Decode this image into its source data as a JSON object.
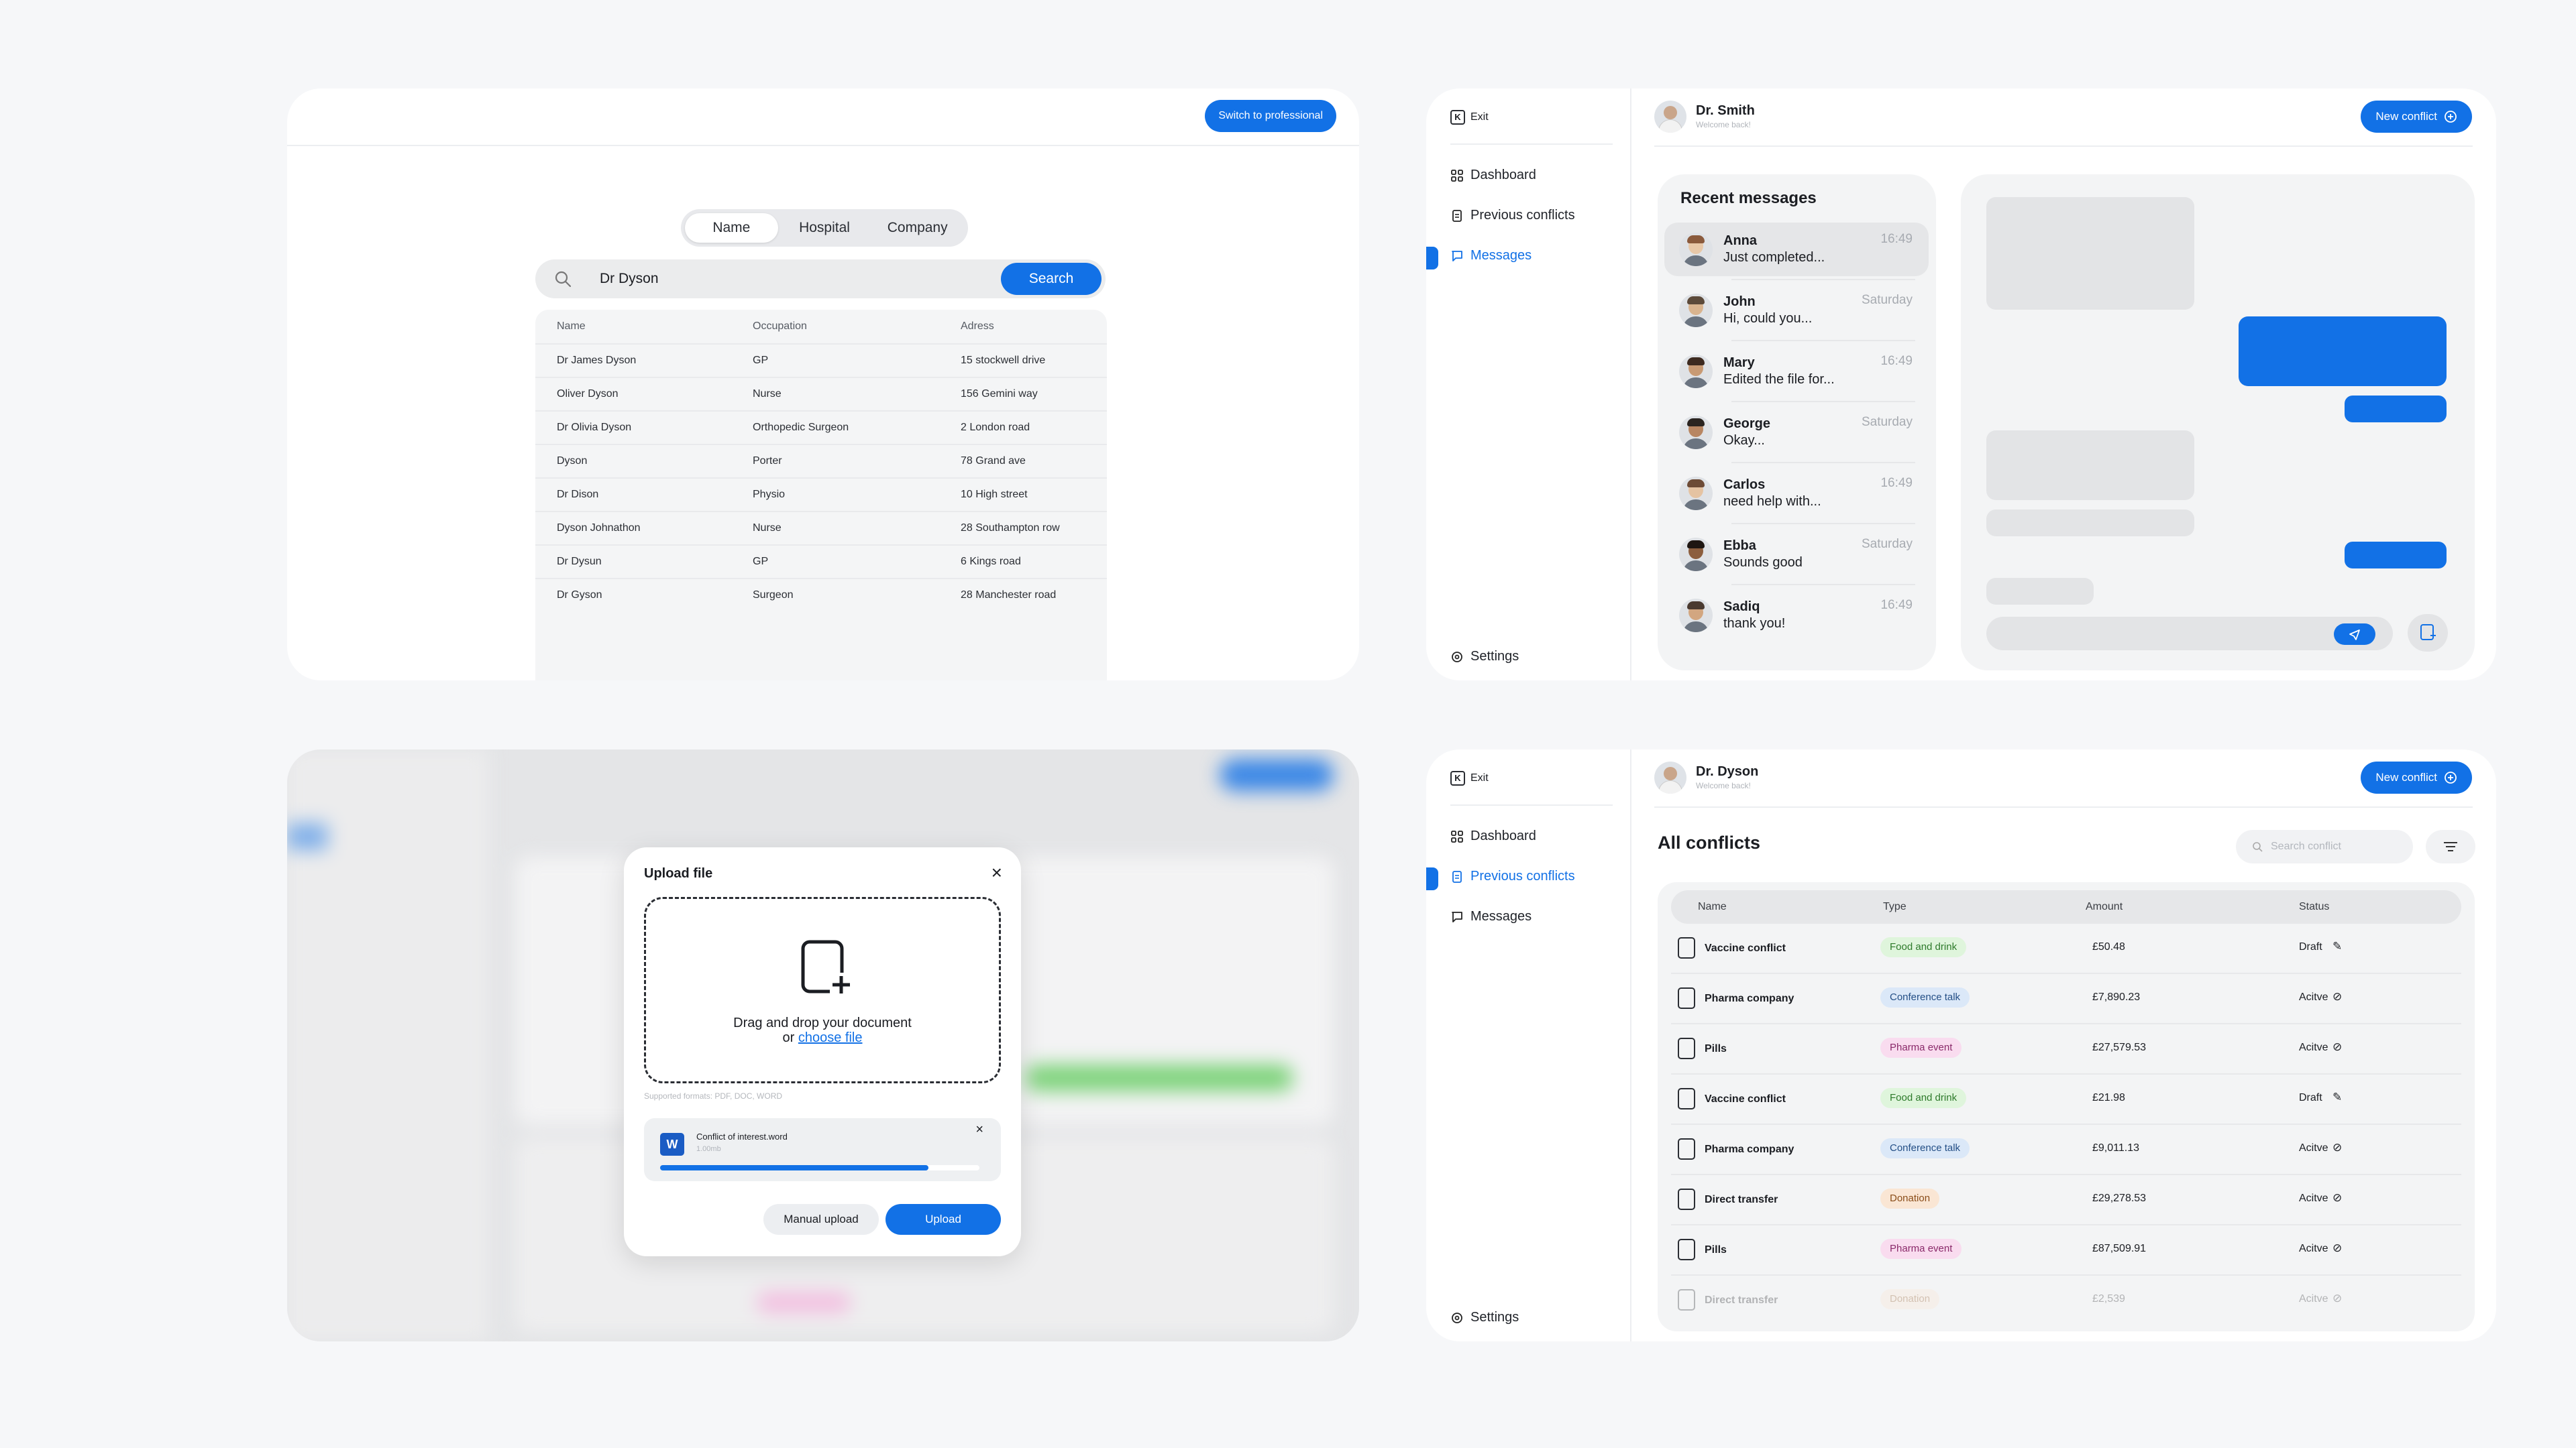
{
  "search_panel": {
    "switch_label": "Switch to professional",
    "tabs": [
      "Name",
      "Hospital",
      "Company"
    ],
    "active_tab": "Name",
    "search_value": "Dr Dyson",
    "search_button": "Search",
    "columns": [
      "Name",
      "Occupation",
      "Adress"
    ],
    "rows": [
      [
        "Dr James Dyson",
        "GP",
        "15 stockwell drive"
      ],
      [
        "Oliver Dyson",
        "Nurse",
        "156 Gemini way"
      ],
      [
        "Dr Olivia Dyson",
        "Orthopedic Surgeon",
        "2 London road"
      ],
      [
        "Dyson",
        "Porter",
        "78 Grand ave"
      ],
      [
        "Dr Dison",
        "Physio",
        "10 High street"
      ],
      [
        "Dyson Johnathon",
        "Nurse",
        "28 Southampton row"
      ],
      [
        "Dr Dysun",
        "GP",
        "6 Kings road"
      ],
      [
        "Dr Gyson",
        "Surgeon",
        "28 Manchester road"
      ]
    ]
  },
  "messages_panel": {
    "nav": {
      "exit": "Exit",
      "dashboard": "Dashboard",
      "previous": "Previous conflicts",
      "messages": "Messages",
      "settings": "Settings"
    },
    "user": {
      "name": "Dr. Smith",
      "subtitle": "Welcome back!"
    },
    "new_conflict": "New conflict",
    "recent_title": "Recent messages",
    "items": [
      {
        "name": "Anna",
        "text": "Just completed...",
        "time": "16:49"
      },
      {
        "name": "John",
        "text": "Hi, could you...",
        "time": "Saturday"
      },
      {
        "name": "Mary",
        "text": "Edited the file for...",
        "time": "16:49"
      },
      {
        "name": "George",
        "text": "Okay...",
        "time": "Saturday"
      },
      {
        "name": "Carlos",
        "text": "need help with...",
        "time": "16:49"
      },
      {
        "name": "Ebba",
        "text": "Sounds good",
        "time": "Saturday"
      },
      {
        "name": "Sadiq",
        "text": "thank you!",
        "time": "16:49"
      }
    ]
  },
  "upload_panel": {
    "title": "Upload file",
    "drop_line1": "Drag and drop your document",
    "drop_line2_prefix": "or ",
    "drop_link": "choose file",
    "formats": "Supported formats: PDF, DOC, WORD",
    "file_name": "Conflict of interest.word",
    "file_size": "1.00mb",
    "progress": 0.84,
    "manual_upload": "Manual upload",
    "upload": "Upload"
  },
  "conflicts_panel": {
    "nav": {
      "exit": "Exit",
      "dashboard": "Dashboard",
      "previous": "Previous conflicts",
      "messages": "Messages",
      "settings": "Settings"
    },
    "user": {
      "name": "Dr. Dyson",
      "subtitle": "Welcome back!"
    },
    "new_conflict": "New conflict",
    "title": "All conflicts",
    "search_placeholder": "Search conflict",
    "columns": [
      "Name",
      "Type",
      "Amount",
      "Status"
    ],
    "rows": [
      {
        "name": "Vaccine conflict",
        "type": "Food and drink",
        "tag": "food",
        "amount": "£50.48",
        "status": "Draft"
      },
      {
        "name": "Pharma company",
        "type": "Conference talk",
        "tag": "conf",
        "amount": "£7,890.23",
        "status": "Acitve"
      },
      {
        "name": "Pills",
        "type": "Pharma event",
        "tag": "pharma",
        "amount": "£27,579.53",
        "status": "Acitve"
      },
      {
        "name": "Vaccine conflict",
        "type": "Food and drink",
        "tag": "food",
        "amount": "£21.98",
        "status": "Draft"
      },
      {
        "name": "Pharma company",
        "type": "Conference talk",
        "tag": "conf",
        "amount": "£9,011.13",
        "status": "Acitve"
      },
      {
        "name": "Direct transfer",
        "type": "Donation",
        "tag": "don",
        "amount": "£29,278.53",
        "status": "Acitve"
      },
      {
        "name": "Pills",
        "type": "Pharma event",
        "tag": "pharma",
        "amount": "£87,509.91",
        "status": "Acitve"
      },
      {
        "name": "Direct transfer",
        "type": "Donation",
        "tag": "don",
        "amount": "£2,539",
        "status": "Acitve"
      }
    ]
  },
  "colors": {
    "accent": "#1271e6",
    "background": "#f6f7f9"
  }
}
